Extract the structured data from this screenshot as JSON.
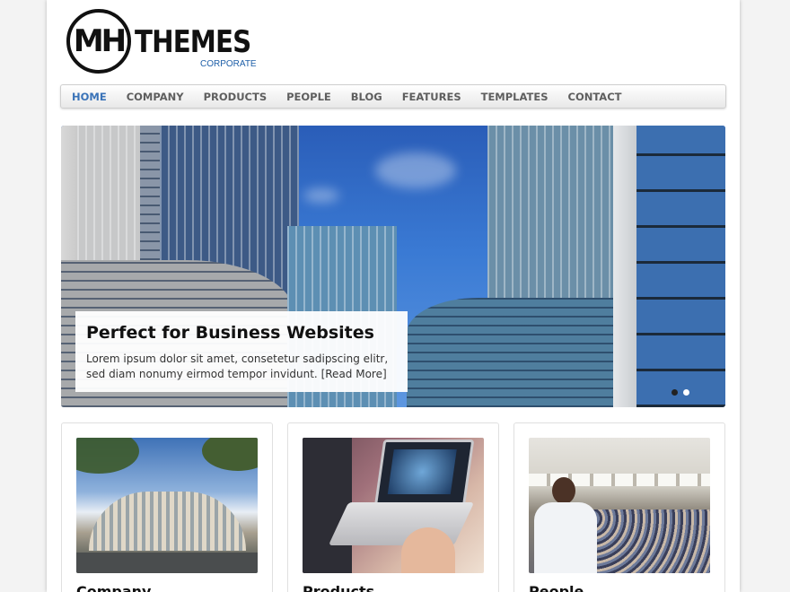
{
  "logo": {
    "mark": "MH",
    "name": "THEMES",
    "tagline": "CORPORATE"
  },
  "nav": {
    "items": [
      {
        "label": "HOME",
        "active": true
      },
      {
        "label": "COMPANY"
      },
      {
        "label": "PRODUCTS"
      },
      {
        "label": "PEOPLE"
      },
      {
        "label": "BLOG"
      },
      {
        "label": "FEATURES"
      },
      {
        "label": "TEMPLATES"
      },
      {
        "label": "CONTACT"
      }
    ],
    "active_color": "#3a73b8",
    "color": "#5e5e5e"
  },
  "slider": {
    "title": "Perfect for Business Websites",
    "text": "Lorem ipsum dolor sit amet, consetetur sadipscing elitr, sed diam nonumy eirmod tempor invidunt.",
    "read_more": "[Read More]",
    "slide_count": 2,
    "active_slide": 2
  },
  "cards": [
    {
      "title": "Company",
      "image": "office-building-photo"
    },
    {
      "title": "Products",
      "image": "laptop-photo"
    },
    {
      "title": "People",
      "image": "conference-photo"
    }
  ]
}
